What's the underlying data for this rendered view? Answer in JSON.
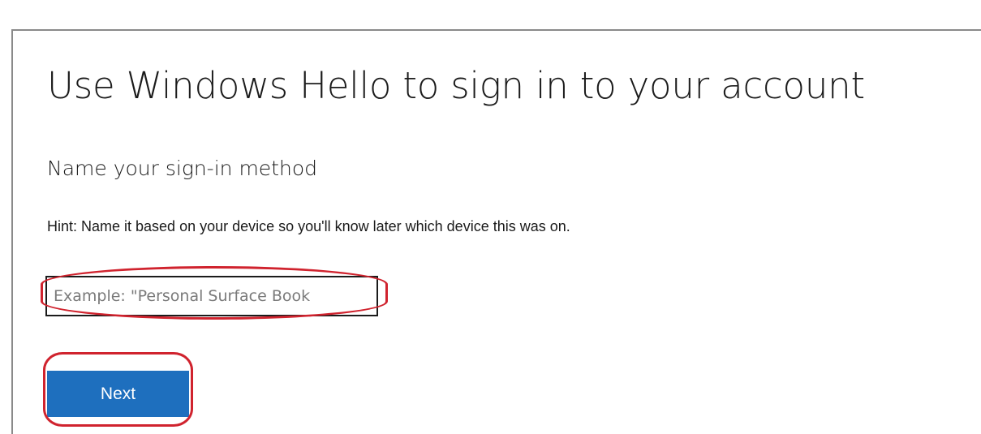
{
  "page": {
    "title": "Use Windows Hello to sign in to your account",
    "subtitle": "Name your sign-in method",
    "hint": "Hint: Name it based on your device so you'll know later which device this was on."
  },
  "form": {
    "name_input": {
      "value": "",
      "placeholder": "Example: \"Personal Surface Book"
    },
    "next_label": "Next"
  },
  "colors": {
    "primary_button": "#1e6fbe",
    "annotation_highlight": "#d0232e"
  }
}
